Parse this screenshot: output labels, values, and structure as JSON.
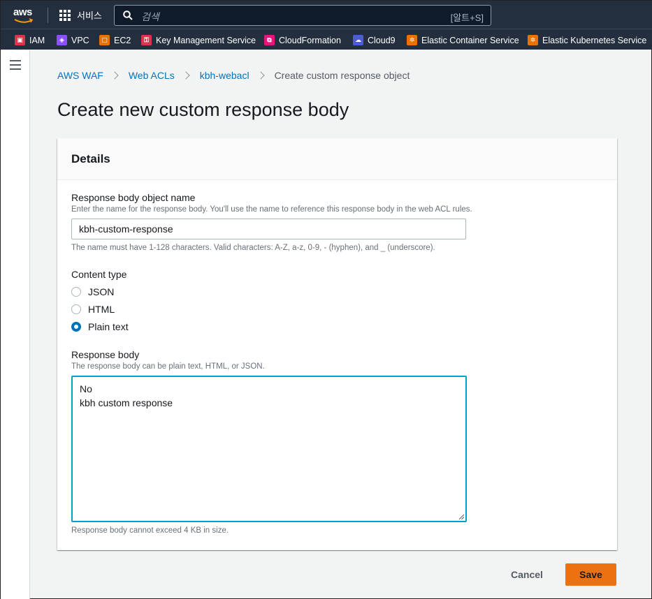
{
  "topnav": {
    "logo_text": "aws",
    "services_label": "서비스",
    "search_placeholder": "검색",
    "search_shortcut": "[알트+S]"
  },
  "favorites": [
    {
      "label": "IAM",
      "color": "#dd344c",
      "icon": "iam-icon"
    },
    {
      "label": "VPC",
      "color": "#8c4fff",
      "icon": "vpc-icon"
    },
    {
      "label": "EC2",
      "color": "#ed7100",
      "icon": "ec2-icon"
    },
    {
      "label": "Key Management Service",
      "color": "#dd344c",
      "icon": "kms-icon"
    },
    {
      "label": "CloudFormation",
      "color": "#e7157b",
      "icon": "cloudformation-icon"
    },
    {
      "label": "Cloud9",
      "color": "#4d5bd8",
      "icon": "cloud9-icon"
    },
    {
      "label": "Elastic Container Service",
      "color": "#ed7100",
      "icon": "ecs-icon"
    },
    {
      "label": "Elastic Kubernetes Service",
      "color": "#ed7100",
      "icon": "eks-icon"
    }
  ],
  "breadcrumb": {
    "items": [
      "AWS WAF",
      "Web ACLs",
      "kbh-webacl"
    ],
    "current": "Create custom response object"
  },
  "page_title": "Create new custom response body",
  "panel": {
    "title": "Details",
    "name_label": "Response body object name",
    "name_desc": "Enter the name for the response body. You'll use the name to reference this response body in the web ACL rules.",
    "name_value": "kbh-custom-response",
    "name_hint": "The name must have 1-128 characters. Valid characters: A-Z, a-z, 0-9, - (hyphen), and _ (underscore).",
    "content_type_label": "Content type",
    "content_types": [
      "JSON",
      "HTML",
      "Plain text"
    ],
    "selected_content_type": "Plain text",
    "body_label": "Response body",
    "body_desc": "The response body can be plain text, HTML, or JSON.",
    "body_lines": [
      "No",
      "kbh custom response"
    ],
    "body_hint": "Response body cannot exceed 4 KB in size."
  },
  "actions": {
    "cancel": "Cancel",
    "save": "Save"
  }
}
